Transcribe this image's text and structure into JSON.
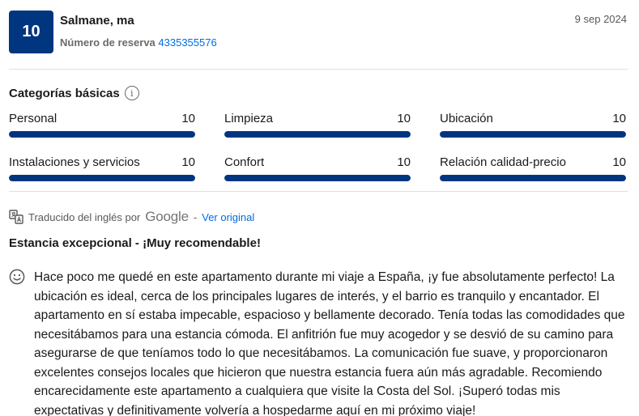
{
  "review": {
    "score": "10",
    "guest_name": "Salmane, ma",
    "booking_label": "Número de reserva",
    "booking_number": "4335355576",
    "date": "9 sep 2024"
  },
  "categories": {
    "title": "Categorías básicas",
    "info_icon": "info-icon",
    "items": [
      {
        "label": "Personal",
        "score": "10",
        "fraction": 1.0
      },
      {
        "label": "Limpieza",
        "score": "10",
        "fraction": 1.0
      },
      {
        "label": "Ubicación",
        "score": "10",
        "fraction": 1.0
      },
      {
        "label": "Instalaciones y servicios",
        "score": "10",
        "fraction": 1.0
      },
      {
        "label": "Confort",
        "score": "10",
        "fraction": 1.0
      },
      {
        "label": "Relación calidad-precio",
        "score": "10",
        "fraction": 1.0
      }
    ]
  },
  "translation": {
    "prefix": "Traducido del inglés por",
    "provider": "Google",
    "separator": "-",
    "link": "Ver original"
  },
  "review_body": {
    "title": "Estancia excepcional - ¡Muy recomendable!",
    "icon": "smiley-icon",
    "text": "Hace poco me quedé en este apartamento durante mi viaje a España, ¡y fue absolutamente perfecto! La ubicación es ideal, cerca de los principales lugares de interés, y el barrio es tranquilo y encantador. El apartamento en sí estaba impecable, espacioso y bellamente decorado. Tenía todas las comodidades que necesitábamos para una estancia cómoda. El anfitrión fue muy acogedor y se desvió de su camino para asegurarse de que teníamos todo lo que necesitábamos. La comunicación fue suave, y proporcionaron excelentes consejos locales que hicieron que nuestra estancia fuera aún más agradable. Recomiendo encarecidamente este apartamento a cualquiera que visite la Costa del Sol. ¡Superó todas mis expectativas y definitivamente volvería a hospedarme aquí en mi próximo viaje!"
  },
  "colors": {
    "brand": "#003580",
    "link": "#006ce4"
  }
}
